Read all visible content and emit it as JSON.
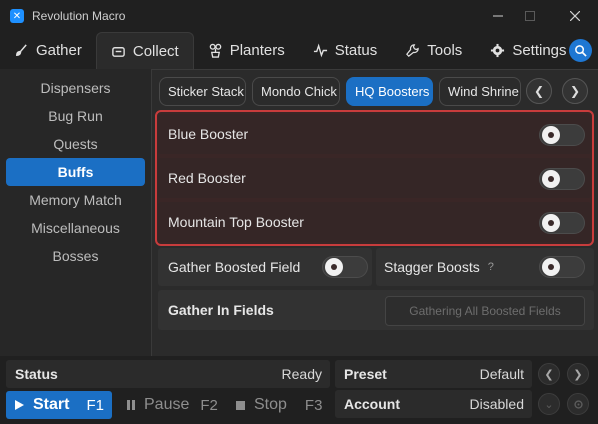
{
  "window": {
    "title": "Revolution Macro",
    "app_icon_glyph": "✕"
  },
  "tabs": [
    {
      "label": "Gather",
      "icon": "brush-icon"
    },
    {
      "label": "Collect",
      "icon": "collect-icon",
      "active": true
    },
    {
      "label": "Planters",
      "icon": "planter-icon"
    },
    {
      "label": "Status",
      "icon": "pulse-icon"
    },
    {
      "label": "Tools",
      "icon": "wrench-icon"
    },
    {
      "label": "Settings",
      "icon": "gear-icon"
    }
  ],
  "sidebar": {
    "items": [
      {
        "label": "Dispensers"
      },
      {
        "label": "Bug Run"
      },
      {
        "label": "Quests"
      },
      {
        "label": "Buffs",
        "active": true
      },
      {
        "label": "Memory Match"
      },
      {
        "label": "Miscellaneous"
      },
      {
        "label": "Bosses"
      }
    ]
  },
  "subtabs": [
    {
      "label": "Sticker Stack"
    },
    {
      "label": "Mondo Chick"
    },
    {
      "label": "HQ Boosters",
      "active": true
    },
    {
      "label": "Wind Shrine"
    }
  ],
  "hq_boosters": [
    {
      "label": "Blue Booster",
      "enabled": false
    },
    {
      "label": "Red Booster",
      "enabled": false
    },
    {
      "label": "Mountain Top Booster",
      "enabled": false
    }
  ],
  "options": {
    "gather_boosted_field": {
      "label": "Gather Boosted Field",
      "enabled": false
    },
    "stagger_boosts": {
      "label": "Stagger Boosts",
      "help": "?",
      "enabled": false
    },
    "gather_in_fields": {
      "label": "Gather In Fields",
      "button": "Gathering All Boosted Fields"
    }
  },
  "bottom": {
    "status": {
      "label": "Status",
      "value": "Ready"
    },
    "preset": {
      "label": "Preset",
      "value": "Default"
    },
    "account": {
      "label": "Account",
      "value": "Disabled"
    },
    "start": {
      "label": "Start",
      "key": "F1"
    },
    "pause": {
      "label": "Pause",
      "key": "F2"
    },
    "stop": {
      "label": "Stop",
      "key": "F3"
    }
  },
  "colors": {
    "accent": "#1b6fc4",
    "highlight_border": "#c83c3c"
  }
}
